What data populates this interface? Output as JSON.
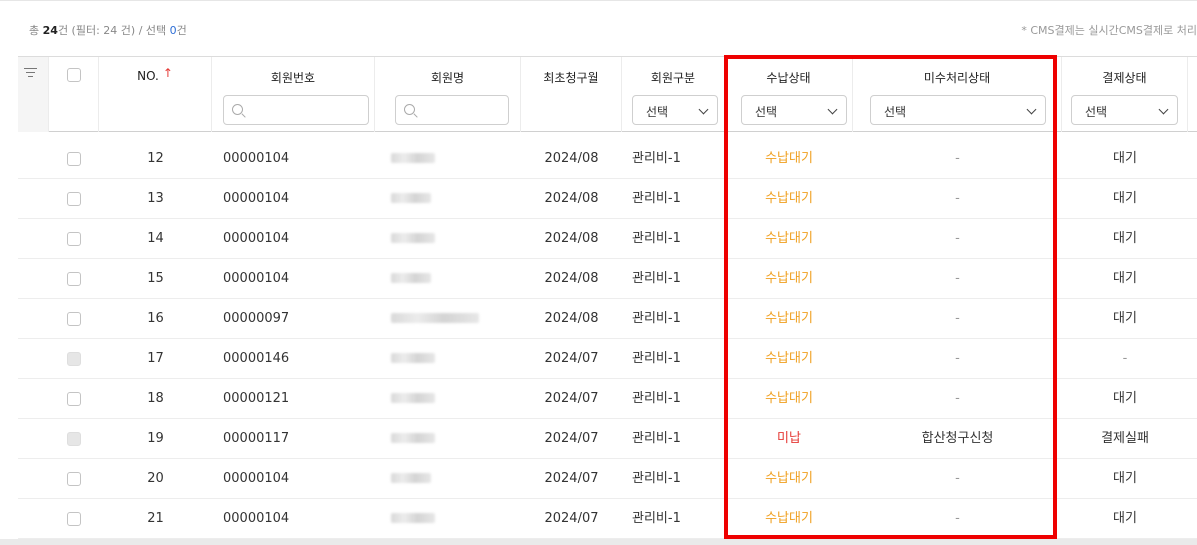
{
  "summary": {
    "prefix": "총 ",
    "total": "24",
    "after_total": "건 (필터: 24 건)  /  선택 ",
    "selected": "0",
    "suffix": "건"
  },
  "note": "* CMS결제는 실시간CMS결제로 처리",
  "headers": {
    "no": "NO.",
    "sort_arrow": "↑",
    "member_no": "회원번호",
    "member_name": "회원명",
    "first_bill_month": "최초청구월",
    "member_type": "회원구분",
    "payment_status": "수납상태",
    "unpaid_status": "미수처리상태",
    "settlement_status": "결제상태"
  },
  "filters": {
    "member_type": "선택",
    "payment_status": "선택",
    "unpaid_status": "선택",
    "settlement_status": "선택"
  },
  "rows": [
    {
      "no": "12",
      "member_no": "00000104",
      "month": "2024/08",
      "type": "관리비-1",
      "pay": "수납대기",
      "unpaid": "-",
      "settle": "대기",
      "disabled": false
    },
    {
      "no": "13",
      "member_no": "00000104",
      "month": "2024/08",
      "type": "관리비-1",
      "pay": "수납대기",
      "unpaid": "-",
      "settle": "대기",
      "disabled": false
    },
    {
      "no": "14",
      "member_no": "00000104",
      "month": "2024/08",
      "type": "관리비-1",
      "pay": "수납대기",
      "unpaid": "-",
      "settle": "대기",
      "disabled": false
    },
    {
      "no": "15",
      "member_no": "00000104",
      "month": "2024/08",
      "type": "관리비-1",
      "pay": "수납대기",
      "unpaid": "-",
      "settle": "대기",
      "disabled": false
    },
    {
      "no": "16",
      "member_no": "00000097",
      "month": "2024/08",
      "type": "관리비-1",
      "pay": "수납대기",
      "unpaid": "-",
      "settle": "대기",
      "disabled": false
    },
    {
      "no": "17",
      "member_no": "00000146",
      "month": "2024/07",
      "type": "관리비-1",
      "pay": "수납대기",
      "unpaid": "-",
      "settle": "-",
      "disabled": true
    },
    {
      "no": "18",
      "member_no": "00000121",
      "month": "2024/07",
      "type": "관리비-1",
      "pay": "수납대기",
      "unpaid": "-",
      "settle": "대기",
      "disabled": false
    },
    {
      "no": "19",
      "member_no": "00000117",
      "month": "2024/07",
      "type": "관리비-1",
      "pay": "미납",
      "unpaid": "합산청구신청",
      "settle": "결제실패",
      "disabled": true
    },
    {
      "no": "20",
      "member_no": "00000104",
      "month": "2024/07",
      "type": "관리비-1",
      "pay": "수납대기",
      "unpaid": "-",
      "settle": "대기",
      "disabled": false
    },
    {
      "no": "21",
      "member_no": "00000104",
      "month": "2024/07",
      "type": "관리비-1",
      "pay": "수납대기",
      "unpaid": "-",
      "settle": "대기",
      "disabled": false
    }
  ],
  "colors": {
    "pending": "#f0a020",
    "unpaid": "#e53935",
    "highlight": "#ee0000",
    "selected_count": "#2f6fd6"
  },
  "icons": [
    "filter-icon",
    "search-icon",
    "chevron-down-icon",
    "sort-up-arrow-icon"
  ]
}
